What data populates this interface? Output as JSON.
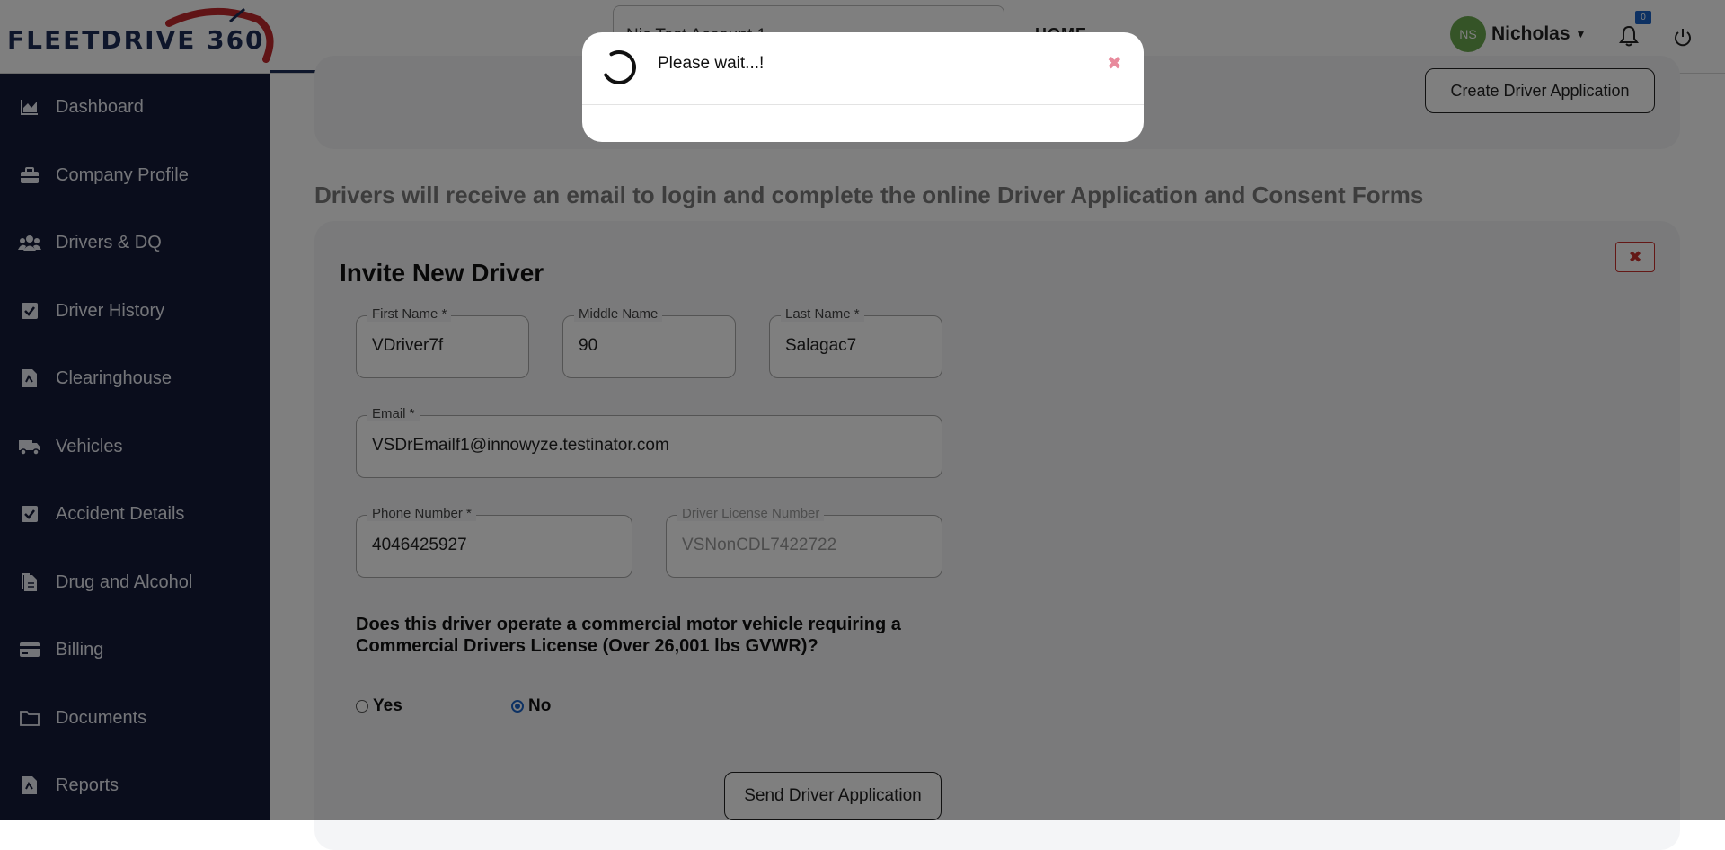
{
  "header": {
    "logo_text": "FLEETDRIVE 360",
    "account_select_value": "Nic Test Account 1",
    "nav_home": "HOME",
    "user": {
      "initials": "NS",
      "name": "Nicholas"
    },
    "notifications_count": "0"
  },
  "sidebar": {
    "items": [
      {
        "label": "Dashboard",
        "icon": "chart-area-icon"
      },
      {
        "label": "Company Profile",
        "icon": "briefcase-icon"
      },
      {
        "label": "Drivers & DQ",
        "icon": "users-icon"
      },
      {
        "label": "Driver History",
        "icon": "check-square-icon"
      },
      {
        "label": "Clearinghouse",
        "icon": "file-icon"
      },
      {
        "label": "Vehicles",
        "icon": "truck-icon"
      },
      {
        "label": "Accident Details",
        "icon": "check-square-icon"
      },
      {
        "label": "Drug and Alcohol",
        "icon": "files-icon"
      },
      {
        "label": "Billing",
        "icon": "credit-card-icon"
      },
      {
        "label": "Documents",
        "icon": "folder-icon"
      },
      {
        "label": "Reports",
        "icon": "file-icon"
      }
    ]
  },
  "main": {
    "create_application_label": "Create Driver Application",
    "info_text": "Drivers will receive an email to login and complete the online Driver Application and Consent Forms",
    "invite": {
      "title": "Invite New Driver",
      "first_name": {
        "label": "First Name *",
        "value": "VDriver7f"
      },
      "middle_name": {
        "label": "Middle Name",
        "value": "90"
      },
      "last_name": {
        "label": "Last Name *",
        "value": "Salagac7"
      },
      "email": {
        "label": "Email *",
        "value": "VSDrEmailf1@innowyze.testinator.com"
      },
      "phone": {
        "label": "Phone Number *",
        "value": "4046425927"
      },
      "license": {
        "label": "Driver License Number",
        "value": "VSNonCDL7422722"
      },
      "question": "Does this driver operate a commercial motor vehicle requiring a Commercial Drivers License (Over 26,001 lbs GVWR)?",
      "yes_label": "Yes",
      "no_label": "No",
      "selected": "No",
      "send_label": "Send Driver Application"
    }
  },
  "modal": {
    "message": "Please wait...!",
    "close_glyph": "✖"
  },
  "colors": {
    "sidebar_bg": "#141a38",
    "brand": "#1c2c56",
    "accent_red": "#c9302c",
    "radio_blue": "#1a63c7",
    "avatar_green": "#6aa84f"
  }
}
